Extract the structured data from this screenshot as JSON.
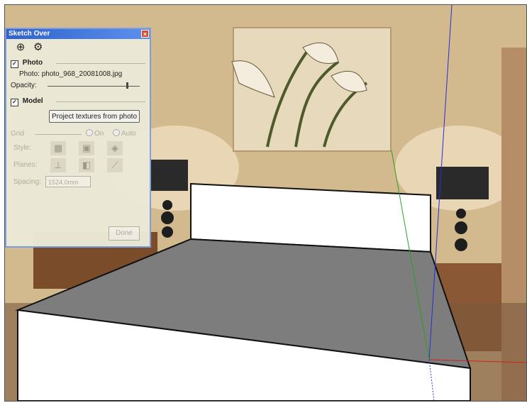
{
  "dialog": {
    "title": "Sketch Over",
    "close_glyph": "×",
    "toolbar_icons": [
      "add-icon",
      "gear-icon"
    ],
    "photo_section": {
      "label": "Photo",
      "checked": true
    },
    "photo_file_label": "Photo:",
    "photo_file_name": "photo_968_20081008.jpg",
    "opacity_label": "Opacity:",
    "opacity_level": 0.85,
    "model_section": {
      "label": "Model",
      "checked": true
    },
    "project_button": "Project textures from photo",
    "grid": {
      "label": "Grid",
      "option_on": "On",
      "option_auto": "Auto",
      "style_label": "Style:",
      "planes_label": "Planes:",
      "spacing_label": "Spacing:",
      "spacing_value": "1524.0mm"
    },
    "done_button": "Done"
  },
  "colors": {
    "titlebar": "#2a5fd0",
    "model_top": "#7d7d7d",
    "model_face": "#ffffff",
    "axis_blue": "#2430d8",
    "axis_green": "#28a028",
    "axis_red": "#d02020"
  }
}
